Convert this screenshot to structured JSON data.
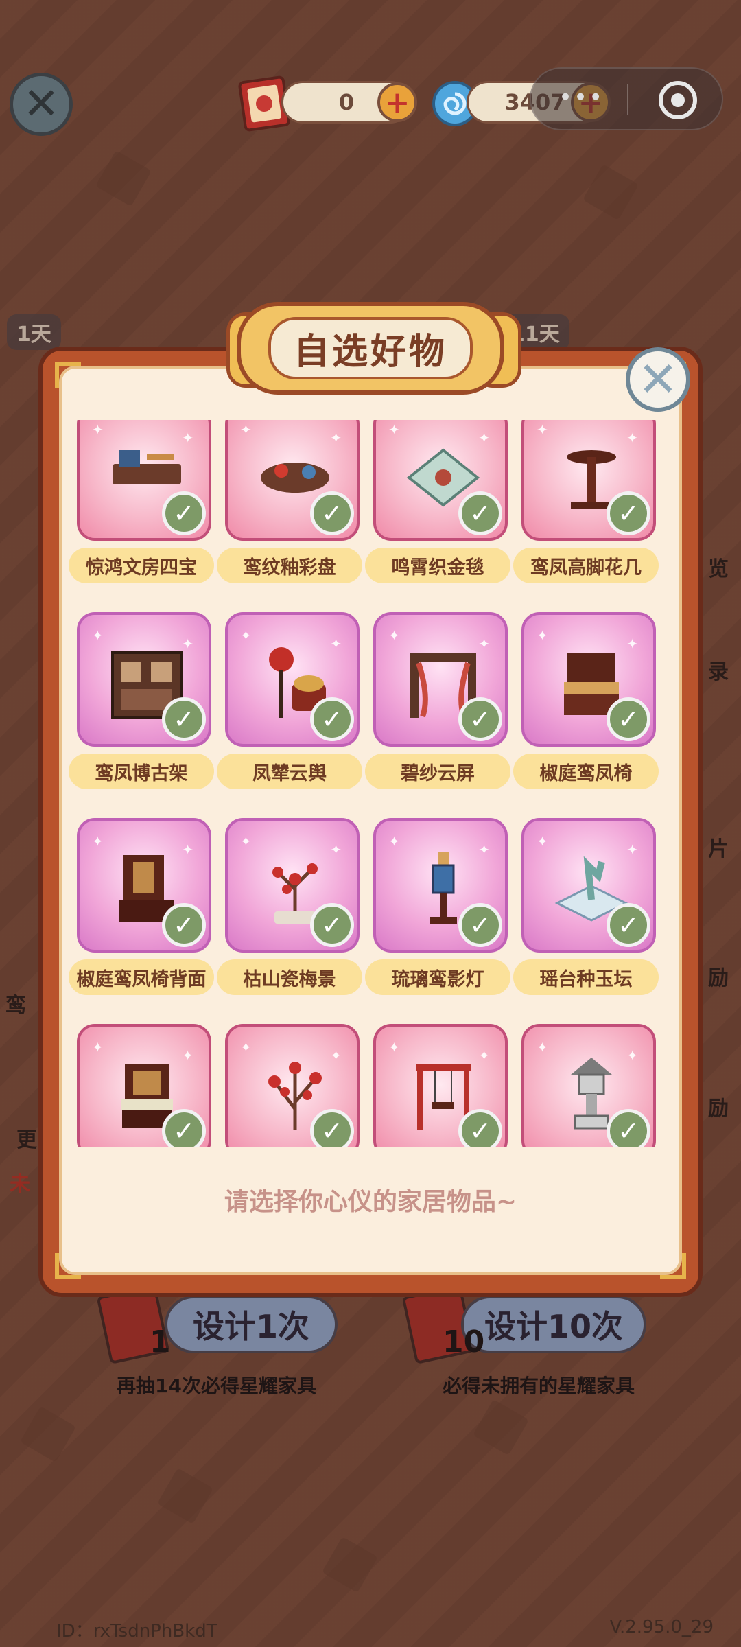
{
  "header": {
    "scroll_count": "0",
    "currency_amount": "3407"
  },
  "behind": {
    "day_left": "1天",
    "day_right": "11天",
    "side_chars": [
      "览",
      "录",
      "片",
      "励",
      "励"
    ],
    "left_chars": [
      "鸾",
      "更",
      "未"
    ]
  },
  "modal": {
    "title": "自选好物",
    "hint": "请选择你心仪的家居物品~",
    "items": [
      {
        "name": "惊鸿文房四宝",
        "style": "pink"
      },
      {
        "name": "鸾纹釉彩盘",
        "style": "pink"
      },
      {
        "name": "鸣霄织金毯",
        "style": "pink"
      },
      {
        "name": "鸾凤高脚花几",
        "style": "pink"
      },
      {
        "name": "鸾凤博古架",
        "style": "purple"
      },
      {
        "name": "凤辇云舆",
        "style": "purple"
      },
      {
        "name": "碧纱云屏",
        "style": "purple"
      },
      {
        "name": "椒庭鸾凤椅",
        "style": "purple"
      },
      {
        "name": "椒庭鸾凤椅背面",
        "style": "purple"
      },
      {
        "name": "枯山瓷梅景",
        "style": "purple"
      },
      {
        "name": "琉璃鸾影灯",
        "style": "purple"
      },
      {
        "name": "瑶台种玉坛",
        "style": "purple"
      },
      {
        "name": "",
        "style": "pink"
      },
      {
        "name": "",
        "style": "pink"
      },
      {
        "name": "",
        "style": "pink"
      },
      {
        "name": "",
        "style": "pink"
      }
    ]
  },
  "bottom": {
    "design_once": "设计1次",
    "design_ten": "设计10次",
    "count_one": "1",
    "count_ten": "10",
    "note_left": "再抽14次必得星耀家具",
    "note_right": "必得未拥有的星耀家具"
  },
  "footer": {
    "id": "ID：rxTsdnPhBkdT",
    "version": "V.2.95.0_29"
  },
  "colors": {
    "accent": "#b9532c",
    "panel": "#fbeedd",
    "label_bg": "#fbe19a",
    "check": "#7e9a67"
  }
}
